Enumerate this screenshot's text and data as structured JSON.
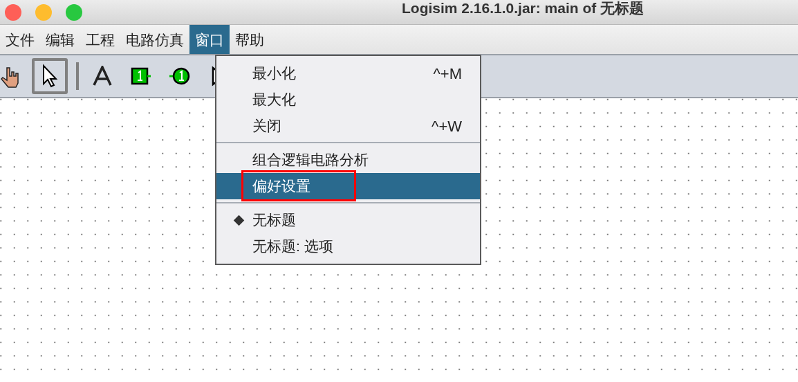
{
  "window": {
    "title": "Logisim 2.16.1.0.jar: main of 无标题"
  },
  "menubar": [
    {
      "label": "文件",
      "selected": false
    },
    {
      "label": "编辑",
      "selected": false
    },
    {
      "label": "工程",
      "selected": false
    },
    {
      "label": "电路仿真",
      "selected": false
    },
    {
      "label": "窗口",
      "selected": true
    },
    {
      "label": "帮助",
      "selected": false
    }
  ],
  "toolbar": [
    {
      "kind": "hand",
      "selected": false
    },
    {
      "kind": "select",
      "selected": true
    },
    {
      "kind": "text",
      "selected": false
    },
    {
      "kind": "input-pin",
      "selected": false
    },
    {
      "kind": "output-pin",
      "selected": false
    },
    {
      "kind": "gate",
      "selected": false
    }
  ],
  "menu": {
    "groups": [
      [
        {
          "label": "最小化",
          "shortcut": "^+M",
          "selected": false,
          "checked": false,
          "annotated": false
        },
        {
          "label": "最大化",
          "selected": false,
          "checked": false,
          "annotated": false
        },
        {
          "label": "关闭",
          "shortcut": "^+W",
          "selected": false,
          "checked": false,
          "annotated": false
        }
      ],
      [
        {
          "label": "组合逻辑电路分析",
          "selected": false,
          "checked": false,
          "annotated": false
        },
        {
          "label": "偏好设置",
          "selected": true,
          "checked": false,
          "annotated": true
        }
      ],
      [
        {
          "label": "无标题",
          "selected": false,
          "checked": true,
          "annotated": false
        },
        {
          "label": "无标题: 选项",
          "selected": false,
          "checked": false,
          "annotated": false
        }
      ]
    ]
  }
}
